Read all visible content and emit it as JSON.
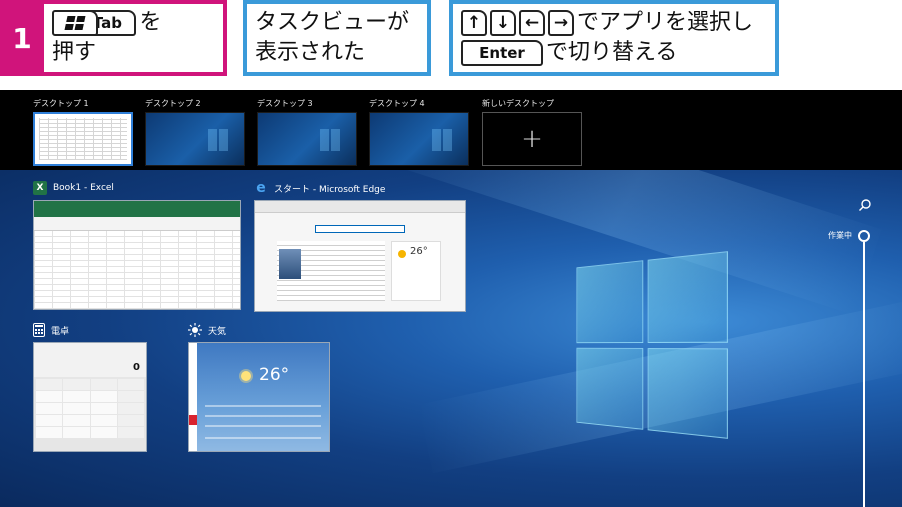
{
  "steps": {
    "number": "1",
    "step1": {
      "suffix": "を",
      "line2": "押す",
      "plus": "+",
      "tab_key": "Tab"
    },
    "step2": {
      "line1": "タスクビューが",
      "line2": "表示された"
    },
    "step3": {
      "line1_suffix": "でアプリを選択し",
      "enter_key": "Enter",
      "line2_suffix": "で切り替える",
      "arrows": [
        "↑",
        "↓",
        "←",
        "→"
      ]
    }
  },
  "virtual_desktops": {
    "items": [
      {
        "label": "デスクトップ 1",
        "active": true
      },
      {
        "label": "デスクトップ 2",
        "active": false
      },
      {
        "label": "デスクトップ 3",
        "active": false
      },
      {
        "label": "デスクトップ 4",
        "active": false
      }
    ],
    "new_desktop": {
      "label": "新しいデスクトップ",
      "icon": "+"
    }
  },
  "windows": {
    "excel": {
      "title": "Book1 - Excel",
      "icon": "X",
      "icon_color": "#217346"
    },
    "edge": {
      "title": "スタート - Microsoft Edge",
      "icon": "e",
      "icon_color": "#1e73d2",
      "weather_temp": "26°"
    },
    "calculator": {
      "title": "電卓",
      "display": "0"
    },
    "weather": {
      "title": "天気",
      "temp": "26°"
    }
  },
  "timeline": {
    "label": "作業中"
  }
}
